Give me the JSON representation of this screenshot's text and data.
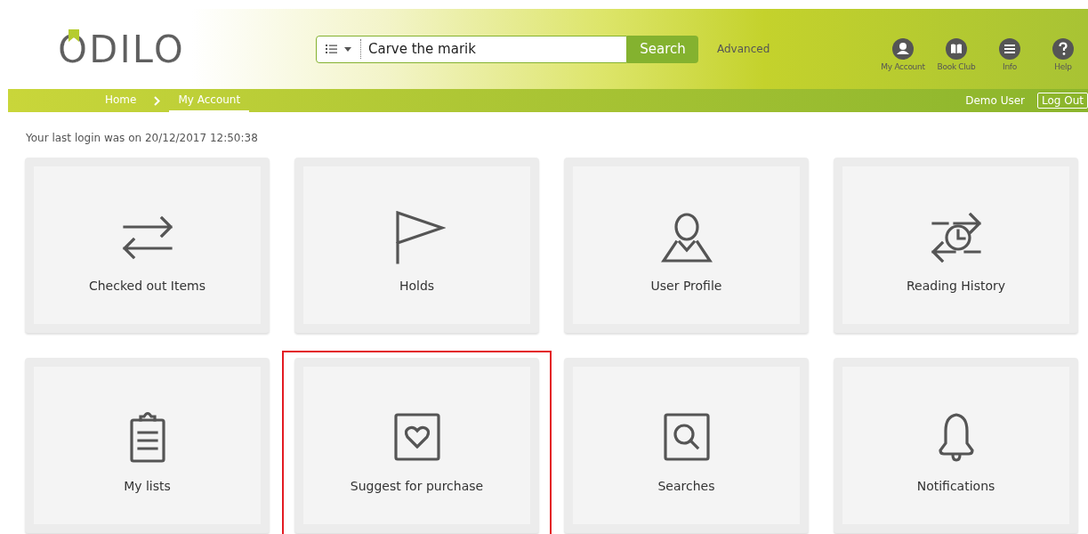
{
  "logo": {
    "text": "ODILO"
  },
  "search": {
    "value": "Carve the marik",
    "button": "Search",
    "advanced": "Advanced"
  },
  "header_links": [
    {
      "label": "My Account",
      "kind": "account"
    },
    {
      "label": "Book Club",
      "kind": "book"
    },
    {
      "label": "Info",
      "kind": "info"
    },
    {
      "label": "Help",
      "kind": "help"
    }
  ],
  "breadcrumbs": [
    {
      "label": "Home",
      "selected": false
    },
    {
      "label": "My Account",
      "selected": true
    }
  ],
  "user": {
    "name": "Demo User",
    "logout": "Log Out"
  },
  "last_login": "Your last login was on 20/12/2017 12:50:38",
  "tiles": [
    {
      "label": "Checked out Items",
      "kind": "exchange",
      "highlighted": false
    },
    {
      "label": "Holds",
      "kind": "flag",
      "highlighted": false
    },
    {
      "label": "User Profile",
      "kind": "user",
      "highlighted": false
    },
    {
      "label": "Reading History",
      "kind": "history",
      "highlighted": false
    },
    {
      "label": "My lists",
      "kind": "clipboard",
      "highlighted": false
    },
    {
      "label": "Suggest for purchase",
      "kind": "heart",
      "highlighted": true
    },
    {
      "label": "Searches",
      "kind": "search",
      "highlighted": false
    },
    {
      "label": "Notifications",
      "kind": "bell",
      "highlighted": false
    }
  ]
}
